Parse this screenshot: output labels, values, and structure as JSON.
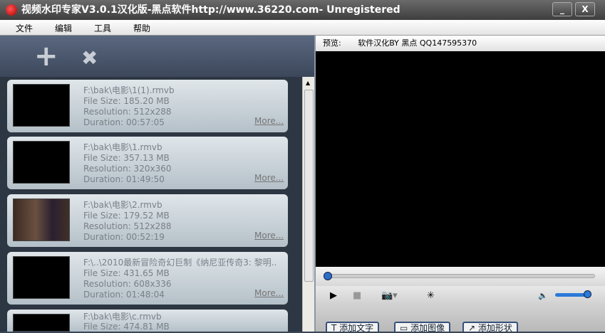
{
  "window": {
    "title": "视频水印专家V3.0.1汉化版-黑点软件http://www.36220.com- Unregistered",
    "minimize": "_",
    "close": "X"
  },
  "menu": [
    "文件",
    "编辑",
    "工具",
    "帮助"
  ],
  "toolbar": {
    "add": "+",
    "remove": "✖"
  },
  "files": [
    {
      "path": "F:\\bak\\电影\\1(1).rmvb",
      "size": "File Size: 185.20 MB",
      "resolution": "Resolution: 512x288",
      "duration": "Duration: 00:57:05",
      "more": "More..."
    },
    {
      "path": "F:\\bak\\电影\\1.rmvb",
      "size": "File Size: 357.13 MB",
      "resolution": "Resolution: 320x360",
      "duration": "Duration: 01:49:50",
      "more": "More..."
    },
    {
      "path": "F:\\bak\\电影\\2.rmvb",
      "size": "File Size: 179.52 MB",
      "resolution": "Resolution: 512x288",
      "duration": "Duration: 00:52:19",
      "more": "More..."
    },
    {
      "path": "F:\\..\\2010最新冒险奇幻巨制《纳尼亚传奇3: 黎明..",
      "size": "File Size: 431.65 MB",
      "resolution": "Resolution: 608x336",
      "duration": "Duration: 01:48:04",
      "more": "More..."
    },
    {
      "path": "F:\\bak\\电影\\c.rmvb",
      "size": "File Size: 474.81 MB",
      "resolution": "",
      "duration": "",
      "more": ""
    }
  ],
  "preview": {
    "label": "预览:",
    "credit": "软件汉化BY 黑点 QQ147595370",
    "progress": 0
  },
  "controls": {
    "play": "▶",
    "stop": "■",
    "snapshot": "📷▾",
    "effects": "✳",
    "volume_icon": "🔈",
    "volume": 1.0
  },
  "actions": [
    "T 添加文字",
    "▭ 添加图像",
    "↗ 添加形状"
  ]
}
